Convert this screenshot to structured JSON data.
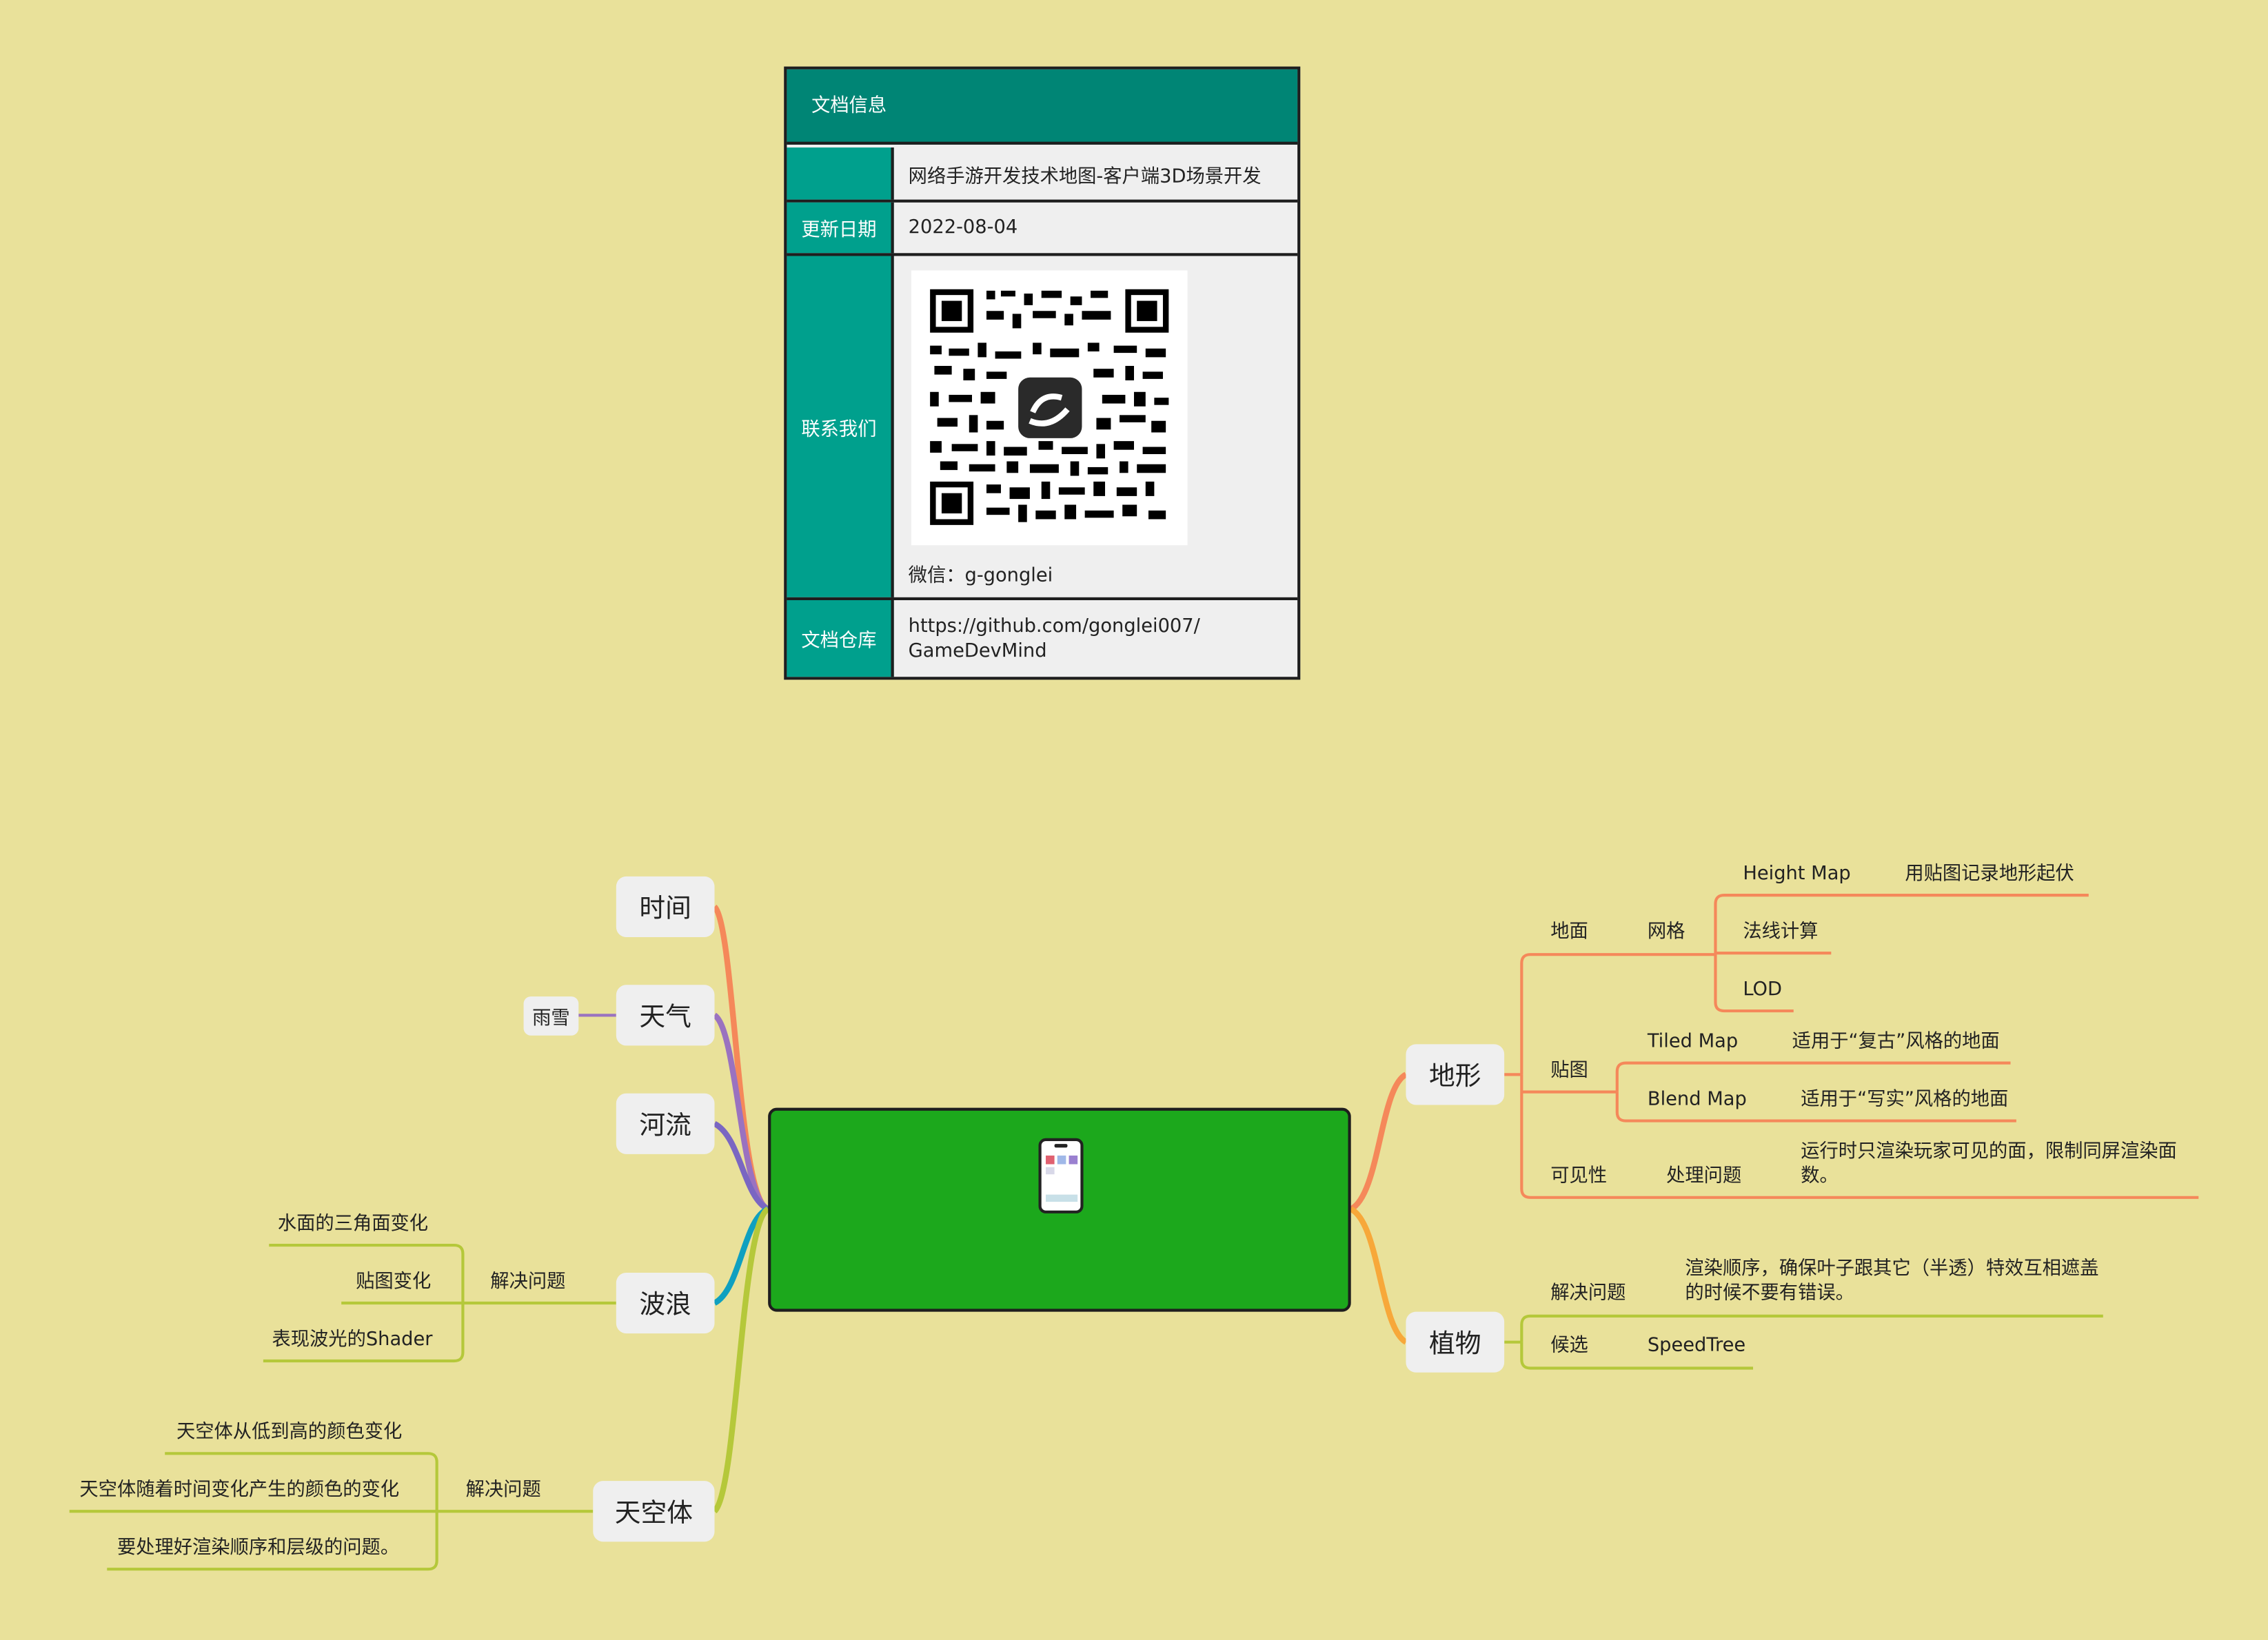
{
  "doc_info": {
    "title": "文档信息",
    "rows": [
      {
        "label": "",
        "value": "网络手游开发技术地图-客户端3D场景开发"
      },
      {
        "label": "更新日期",
        "value": "2022-08-04"
      },
      {
        "label": "联系我们",
        "value": "微信：g-gonglei"
      },
      {
        "label": "文档仓库",
        "value_line1": "https://github.com/gonglei007/",
        "value_line2": "GameDevMind"
      }
    ]
  },
  "center": {
    "icon": "phone-app-icon",
    "color": "#1ca81c"
  },
  "left": {
    "time": {
      "label": "时间"
    },
    "weather": {
      "label": "天气",
      "child": "雨雪"
    },
    "river": {
      "label": "河流"
    },
    "wave": {
      "label": "波浪",
      "sub": "解决问题",
      "items": [
        "水面的三角面变化",
        "贴图变化",
        "表现波光的Shader"
      ]
    },
    "sky": {
      "label": "天空体",
      "sub": "解决问题",
      "items": [
        "天空体从低到高的颜色变化",
        "天空体随着时间变化产生的颜色的变化",
        "要处理好渲染顺序和层级的问题。"
      ]
    }
  },
  "right": {
    "terrain": {
      "label": "地形",
      "ground": {
        "label": "地面",
        "mesh": "网格",
        "height_map": "Height Map",
        "height_map_desc": "用贴图记录地形起伏",
        "normal": "法线计算",
        "lod": "LOD"
      },
      "texture": {
        "label": "贴图",
        "tiled": "Tiled Map",
        "tiled_desc": "适用于“复古”风格的地面",
        "blend": "Blend Map",
        "blend_desc": "适用于“写实”风格的地面"
      },
      "visibility": {
        "label": "可见性",
        "sub": "处理问题",
        "desc": "运行时只渲染玩家可见的面，限制同屏渲染面数。"
      }
    },
    "plants": {
      "label": "植物",
      "solve": "解决问题",
      "solve_desc": "渲染顺序，确保叶子跟其它（半透）特效互相遮盖的时候不要有错误。",
      "candidate": "候选",
      "candidate_value": "SpeedTree"
    }
  },
  "colors": {
    "time": "#f5885a",
    "weather": "#9a72c0",
    "river": "#7a66c2",
    "wave": "#0fa0c0",
    "sky": "#b5c83a",
    "terrain": "#f5885a",
    "plants": "#f7a83a",
    "teal_dark": "#008575",
    "teal": "#00a08d"
  }
}
